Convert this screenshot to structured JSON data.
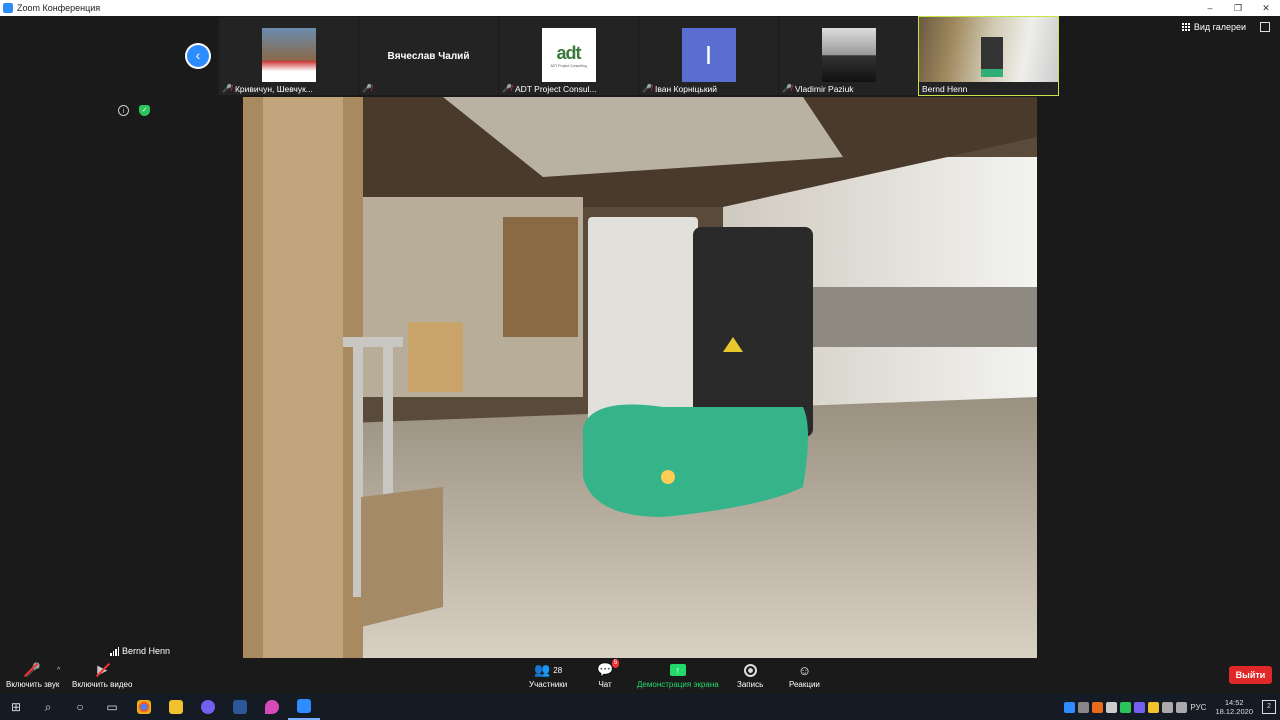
{
  "window": {
    "title": "Zoom Конференция",
    "controls": [
      "–",
      "❐",
      "✕"
    ]
  },
  "gallery_view": {
    "label": "Вид галереи"
  },
  "participants_strip": [
    {
      "name": "Кривичун, Шевчук...",
      "muted": true,
      "type": "photo"
    },
    {
      "name": "",
      "display": "Вячеслав Чалий",
      "muted": true,
      "type": "name"
    },
    {
      "name": "ADT Project Consul...",
      "muted": true,
      "type": "logo",
      "logo_main": "adt",
      "logo_sub": "ADT Project Consulting"
    },
    {
      "name": "Іван Корніцький",
      "muted": true,
      "type": "initial",
      "initial": "I"
    },
    {
      "name": "Vladimir Paziuk",
      "muted": true,
      "type": "photo-bw"
    },
    {
      "name": "Bernd Henn",
      "muted": false,
      "type": "video",
      "active": true
    }
  ],
  "active_speaker": {
    "name": "Bernd Henn"
  },
  "toolbar": {
    "audio_label": "Включить звук",
    "video_label": "Включить видео",
    "participants_label": "Участники",
    "participants_count": "28",
    "chat_label": "Чат",
    "chat_badge": "5",
    "share_label": "Демонстрация экрана",
    "record_label": "Запись",
    "reactions_label": "Реакции",
    "leave_label": "Выйти"
  },
  "taskbar": {
    "language": "РУС",
    "time": "14:52",
    "date": "18.12.2020",
    "notifications": "2"
  },
  "colors": {
    "accent": "#2d8cff",
    "share_green": "#23d96c",
    "leave_red": "#e02828",
    "active_border": "#c5e44a"
  }
}
